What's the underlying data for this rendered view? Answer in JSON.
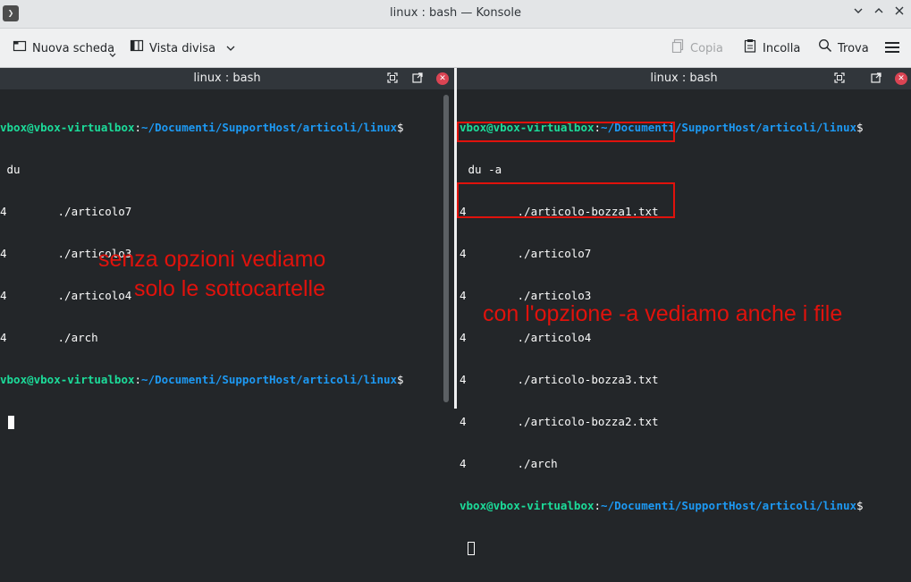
{
  "window": {
    "title": "linux : bash — Konsole",
    "app_icon_glyph": "❯"
  },
  "toolbar": {
    "new_tab_label": "Nuova scheda",
    "split_view_label": "Vista divisa",
    "copy_label": "Copia",
    "paste_label": "Incolla",
    "find_label": "Trova"
  },
  "left_pane": {
    "title": "linux : bash",
    "prompt_user": "vbox@vbox-virtualbox",
    "prompt_sep": ":",
    "prompt_path": "~/Documenti/SupportHost/articoli/linux",
    "prompt_symbol": "$",
    "command": " du",
    "output": [
      {
        "size": "4",
        "path": "./articolo7"
      },
      {
        "size": "4",
        "path": "./articolo3"
      },
      {
        "size": "4",
        "path": "./articolo4"
      },
      {
        "size": "4",
        "path": "./arch"
      }
    ],
    "annotation_line1": "senza opzioni vediamo",
    "annotation_line2": "solo le sottocartelle"
  },
  "right_pane": {
    "title": "linux : bash",
    "prompt_user": "vbox@vbox-virtualbox",
    "prompt_sep": ":",
    "prompt_path": "~/Documenti/SupportHost/articoli/linux",
    "prompt_symbol": "$",
    "command": " du -a",
    "output": [
      {
        "size": "4",
        "path": "./articolo-bozza1.txt",
        "highlighted": true
      },
      {
        "size": "4",
        "path": "./articolo7",
        "highlighted": false
      },
      {
        "size": "4",
        "path": "./articolo3",
        "highlighted": false
      },
      {
        "size": "4",
        "path": "./articolo4",
        "highlighted": false
      },
      {
        "size": "4",
        "path": "./articolo-bozza3.txt",
        "highlighted": true
      },
      {
        "size": "4",
        "path": "./articolo-bozza2.txt",
        "highlighted": true
      },
      {
        "size": "4",
        "path": "./arch",
        "highlighted": false
      }
    ],
    "annotation": "con l'opzione -a vediamo anche i file"
  },
  "colors": {
    "terminal_bg": "#232629",
    "prompt_user": "#1cdc9a",
    "prompt_path": "#1d99f3",
    "annotation_red": "#e0120c",
    "close_button": "#da4453"
  }
}
